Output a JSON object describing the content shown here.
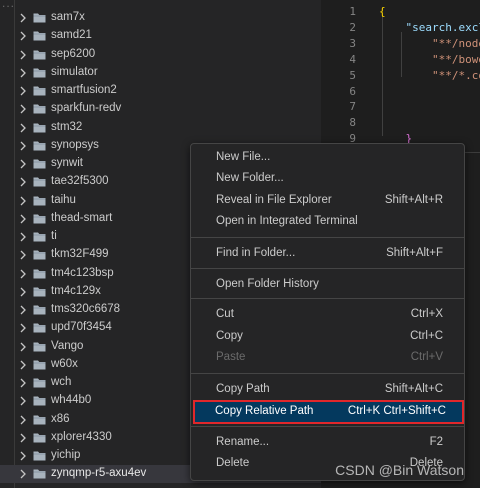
{
  "explorer": {
    "top_faded_text": "...",
    "folders": [
      "sam7x",
      "samd21",
      "sep6200",
      "simulator",
      "smartfusion2",
      "sparkfun-redv",
      "stm32",
      "synopsys",
      "synwit",
      "tae32f5300",
      "taihu",
      "thead-smart",
      "ti",
      "tkm32F499",
      "tm4c123bsp",
      "tm4c129x",
      "tms320c6678",
      "upd70f3454",
      "Vango",
      "w60x",
      "wch",
      "wh44b0",
      "x86",
      "xplorer4330",
      "yichip",
      "zynqmp-r5-axu4ev"
    ],
    "selected_folder": "zynqmp-r5-axu4ev"
  },
  "editor": {
    "line_numbers": [
      "1",
      "2",
      "3",
      "4",
      "5",
      "6",
      "7",
      "8",
      "9"
    ],
    "lines": [
      "{",
      "    \"search.excl",
      "        \"**/node",
      "        \"**/bowe",
      "        \"**/*.co",
      "",
      "",
      "",
      "    }"
    ]
  },
  "context_menu": {
    "items": [
      {
        "label": "New File...",
        "shortcut": ""
      },
      {
        "label": "New Folder...",
        "shortcut": ""
      },
      {
        "label": "Reveal in File Explorer",
        "shortcut": "Shift+Alt+R"
      },
      {
        "label": "Open in Integrated Terminal",
        "shortcut": ""
      },
      {
        "label": "Find in Folder...",
        "shortcut": "Shift+Alt+F"
      },
      {
        "label": "Open Folder History",
        "shortcut": ""
      },
      {
        "label": "Cut",
        "shortcut": "Ctrl+X"
      },
      {
        "label": "Copy",
        "shortcut": "Ctrl+C"
      },
      {
        "label": "Paste",
        "shortcut": "Ctrl+V"
      },
      {
        "label": "Copy Path",
        "shortcut": "Shift+Alt+C"
      },
      {
        "label": "Copy Relative Path",
        "shortcut": "Ctrl+K Ctrl+Shift+C"
      },
      {
        "label": "Rename...",
        "shortcut": "F2"
      },
      {
        "label": "Delete",
        "shortcut": "Delete"
      }
    ],
    "disabled_item": "Paste",
    "highlighted_item": "Copy Relative Path",
    "highlight_border_color": "#e0272b"
  },
  "watermark": {
    "text": "CSDN @Bin Watson"
  },
  "colors": {
    "explorer_bg": "#252526",
    "editor_bg": "#1e1e1e",
    "menu_highlight": "#04395e",
    "string": "#ce9178",
    "property": "#9cdcfe"
  }
}
